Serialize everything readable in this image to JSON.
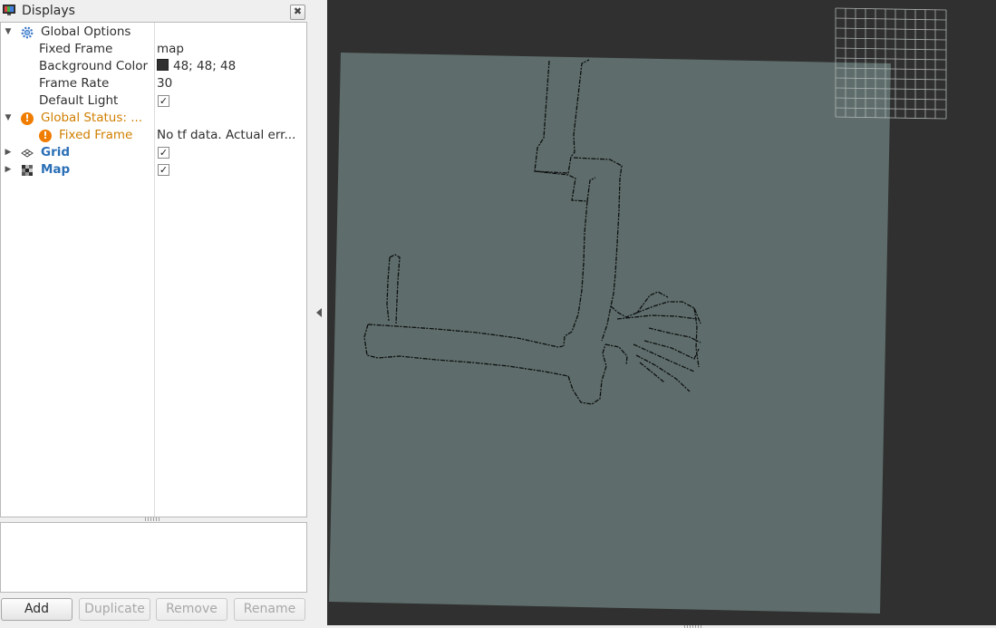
{
  "panel": {
    "title": "Displays",
    "close_label": "✖"
  },
  "tree": {
    "global_options": {
      "label": "Global Options",
      "fixed_frame": {
        "label": "Fixed Frame",
        "value": "map"
      },
      "background_color": {
        "label": "Background Color",
        "value": "48; 48; 48"
      },
      "frame_rate": {
        "label": "Frame Rate",
        "value": "30"
      },
      "default_light": {
        "label": "Default Light",
        "checked": true
      }
    },
    "global_status": {
      "label": "Global Status: ...",
      "fixed_frame": {
        "label": "Fixed Frame",
        "value": "No tf data.  Actual err..."
      }
    },
    "grid": {
      "label": "Grid",
      "checked": true
    },
    "map": {
      "label": "Map",
      "checked": true
    }
  },
  "buttons": {
    "add": "Add",
    "duplicate": "Duplicate",
    "remove": "Remove",
    "rename": "Rename"
  },
  "glyphs": {
    "check": "✓",
    "expanded": "▼",
    "collapsed": "▶",
    "warning": "!"
  },
  "colors": {
    "view_background": "#303030",
    "map_plane": "#5e6d6b",
    "warning": "#f07d00",
    "display_name": "#2a6fb6"
  },
  "icons": [
    "monitor-icon",
    "gear-icon",
    "warning-icon",
    "grid-icon",
    "map-icon"
  ]
}
